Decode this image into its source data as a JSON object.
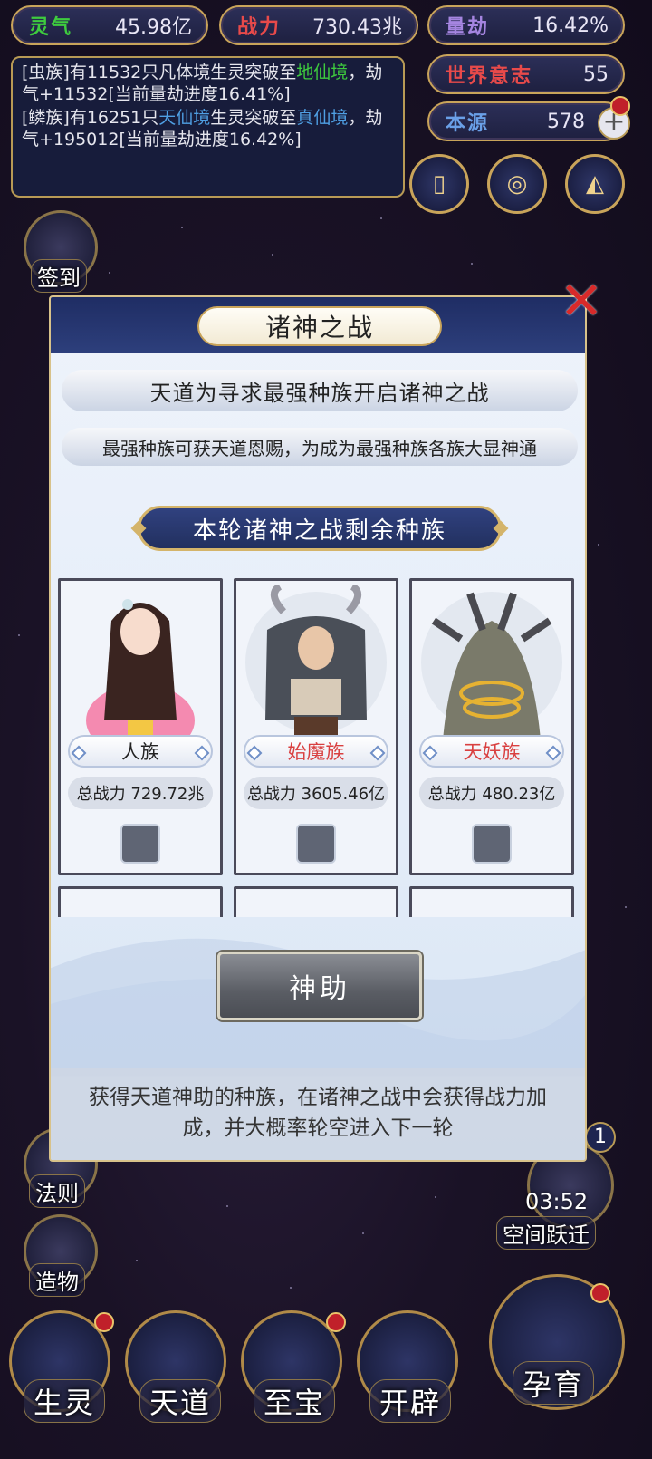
{
  "stats": {
    "lingqi_label": "灵气",
    "lingqi_value": "45.98亿",
    "zhanli_label": "战力",
    "zhanli_value": "730.43兆",
    "liangjie_label": "量劫",
    "liangjie_value": "16.42%",
    "shijie_label": "世界意志",
    "shijie_value": "55",
    "benyuan_label": "本源",
    "benyuan_value": "578",
    "colors": {
      "lingqi": "#3ecb3e",
      "zhanli": "#e84a4a",
      "liangjie": "#a585e0",
      "shijie": "#e84a4a",
      "benyuan": "#6aa0e8"
    }
  },
  "log": {
    "line1_prefix": "[虫族]有11532只凡体境生灵突破至",
    "line1_highlight": "地仙境",
    "line1_suffix": "，劫气+11532[当前量劫进度16.41%]",
    "line2_prefix": "[鳞族]有16251只",
    "line2_highlight1": "天仙境",
    "line2_mid": "生灵突破至",
    "line2_highlight2": "真仙境",
    "line2_suffix": "，劫气+195012[当前量劫进度16.42%]"
  },
  "side": {
    "checkin": "签到",
    "fa_ze": "法则",
    "zao_wu": "造物",
    "timer": "03:52",
    "space_jump": "空间跃迁",
    "count_badge": "1"
  },
  "modal": {
    "title": "诸神之战",
    "close_symbol": "✕",
    "banner1": "天道为寻求最强种族开启诸神之战",
    "banner2": "最强种族可获天道恩赐，为成为最强种族各族大显神通",
    "section_title": "本轮诸神之战剩余种族",
    "races": [
      {
        "name": "人族",
        "power": "总战力 729.72兆",
        "name_color": "#222222"
      },
      {
        "name": "始魔族",
        "power": "总战力 3605.46亿",
        "name_color": "#d94040"
      },
      {
        "name": "天妖族",
        "power": "总战力 480.23亿",
        "name_color": "#d94040"
      }
    ],
    "bless_button": "神助",
    "description": "获得天道神助的种族，在诸神之战中会获得战力加成，并大概率轮空进入下一轮"
  },
  "nav": {
    "sheng_ling": "生灵",
    "tian_dao": "天道",
    "zhi_bao": "至宝",
    "kai_pi": "开辟",
    "yun_yu": "孕育"
  }
}
